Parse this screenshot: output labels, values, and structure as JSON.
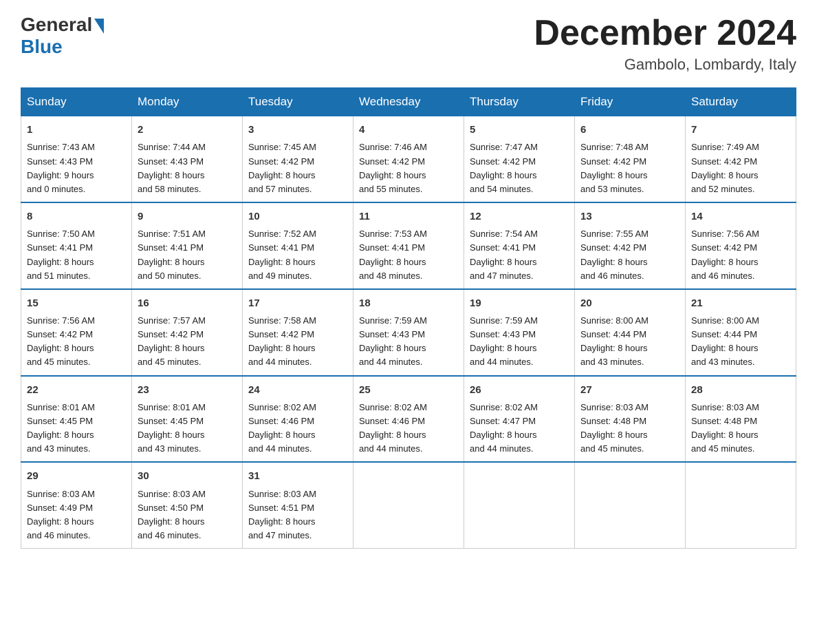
{
  "header": {
    "logo_general": "General",
    "logo_blue": "Blue",
    "month_title": "December 2024",
    "location": "Gambolo, Lombardy, Italy"
  },
  "days_of_week": [
    "Sunday",
    "Monday",
    "Tuesday",
    "Wednesday",
    "Thursday",
    "Friday",
    "Saturday"
  ],
  "weeks": [
    [
      {
        "day": "1",
        "sunrise": "7:43 AM",
        "sunset": "4:43 PM",
        "daylight_h": "9",
        "daylight_m": "0"
      },
      {
        "day": "2",
        "sunrise": "7:44 AM",
        "sunset": "4:43 PM",
        "daylight_h": "8",
        "daylight_m": "58"
      },
      {
        "day": "3",
        "sunrise": "7:45 AM",
        "sunset": "4:42 PM",
        "daylight_h": "8",
        "daylight_m": "57"
      },
      {
        "day": "4",
        "sunrise": "7:46 AM",
        "sunset": "4:42 PM",
        "daylight_h": "8",
        "daylight_m": "55"
      },
      {
        "day": "5",
        "sunrise": "7:47 AM",
        "sunset": "4:42 PM",
        "daylight_h": "8",
        "daylight_m": "54"
      },
      {
        "day": "6",
        "sunrise": "7:48 AM",
        "sunset": "4:42 PM",
        "daylight_h": "8",
        "daylight_m": "53"
      },
      {
        "day": "7",
        "sunrise": "7:49 AM",
        "sunset": "4:42 PM",
        "daylight_h": "8",
        "daylight_m": "52"
      }
    ],
    [
      {
        "day": "8",
        "sunrise": "7:50 AM",
        "sunset": "4:41 PM",
        "daylight_h": "8",
        "daylight_m": "51"
      },
      {
        "day": "9",
        "sunrise": "7:51 AM",
        "sunset": "4:41 PM",
        "daylight_h": "8",
        "daylight_m": "50"
      },
      {
        "day": "10",
        "sunrise": "7:52 AM",
        "sunset": "4:41 PM",
        "daylight_h": "8",
        "daylight_m": "49"
      },
      {
        "day": "11",
        "sunrise": "7:53 AM",
        "sunset": "4:41 PM",
        "daylight_h": "8",
        "daylight_m": "48"
      },
      {
        "day": "12",
        "sunrise": "7:54 AM",
        "sunset": "4:41 PM",
        "daylight_h": "8",
        "daylight_m": "47"
      },
      {
        "day": "13",
        "sunrise": "7:55 AM",
        "sunset": "4:42 PM",
        "daylight_h": "8",
        "daylight_m": "46"
      },
      {
        "day": "14",
        "sunrise": "7:56 AM",
        "sunset": "4:42 PM",
        "daylight_h": "8",
        "daylight_m": "46"
      }
    ],
    [
      {
        "day": "15",
        "sunrise": "7:56 AM",
        "sunset": "4:42 PM",
        "daylight_h": "8",
        "daylight_m": "45"
      },
      {
        "day": "16",
        "sunrise": "7:57 AM",
        "sunset": "4:42 PM",
        "daylight_h": "8",
        "daylight_m": "45"
      },
      {
        "day": "17",
        "sunrise": "7:58 AM",
        "sunset": "4:42 PM",
        "daylight_h": "8",
        "daylight_m": "44"
      },
      {
        "day": "18",
        "sunrise": "7:59 AM",
        "sunset": "4:43 PM",
        "daylight_h": "8",
        "daylight_m": "44"
      },
      {
        "day": "19",
        "sunrise": "7:59 AM",
        "sunset": "4:43 PM",
        "daylight_h": "8",
        "daylight_m": "44"
      },
      {
        "day": "20",
        "sunrise": "8:00 AM",
        "sunset": "4:44 PM",
        "daylight_h": "8",
        "daylight_m": "43"
      },
      {
        "day": "21",
        "sunrise": "8:00 AM",
        "sunset": "4:44 PM",
        "daylight_h": "8",
        "daylight_m": "43"
      }
    ],
    [
      {
        "day": "22",
        "sunrise": "8:01 AM",
        "sunset": "4:45 PM",
        "daylight_h": "8",
        "daylight_m": "43"
      },
      {
        "day": "23",
        "sunrise": "8:01 AM",
        "sunset": "4:45 PM",
        "daylight_h": "8",
        "daylight_m": "43"
      },
      {
        "day": "24",
        "sunrise": "8:02 AM",
        "sunset": "4:46 PM",
        "daylight_h": "8",
        "daylight_m": "44"
      },
      {
        "day": "25",
        "sunrise": "8:02 AM",
        "sunset": "4:46 PM",
        "daylight_h": "8",
        "daylight_m": "44"
      },
      {
        "day": "26",
        "sunrise": "8:02 AM",
        "sunset": "4:47 PM",
        "daylight_h": "8",
        "daylight_m": "44"
      },
      {
        "day": "27",
        "sunrise": "8:03 AM",
        "sunset": "4:48 PM",
        "daylight_h": "8",
        "daylight_m": "45"
      },
      {
        "day": "28",
        "sunrise": "8:03 AM",
        "sunset": "4:48 PM",
        "daylight_h": "8",
        "daylight_m": "45"
      }
    ],
    [
      {
        "day": "29",
        "sunrise": "8:03 AM",
        "sunset": "4:49 PM",
        "daylight_h": "8",
        "daylight_m": "46"
      },
      {
        "day": "30",
        "sunrise": "8:03 AM",
        "sunset": "4:50 PM",
        "daylight_h": "8",
        "daylight_m": "46"
      },
      {
        "day": "31",
        "sunrise": "8:03 AM",
        "sunset": "4:51 PM",
        "daylight_h": "8",
        "daylight_m": "47"
      },
      null,
      null,
      null,
      null
    ]
  ]
}
